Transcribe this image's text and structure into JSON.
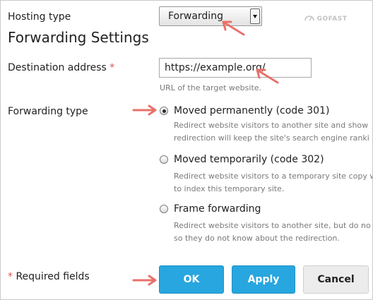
{
  "hosting": {
    "label": "Hosting type",
    "selected": "Forwarding"
  },
  "section_title": "Forwarding Settings",
  "destination": {
    "label": "Destination address",
    "required_mark": "*",
    "value": "https://example.org/",
    "hint": "URL of the target website."
  },
  "forwarding": {
    "label": "Forwarding type",
    "options": [
      {
        "label": "Moved permanently (code 301)",
        "checked": true,
        "desc1": "Redirect website visitors to another site and show",
        "desc2": "redirection will keep the site's search engine ranki"
      },
      {
        "label": "Moved temporarily (code 302)",
        "checked": false,
        "desc1": "Redirect website visitors to a temporary site copy w",
        "desc2": "to index this temporary site."
      },
      {
        "label": "Frame forwarding",
        "checked": false,
        "desc1": "Redirect website visitors to another site, but do no",
        "desc2": "so they do not know about the redirection."
      }
    ]
  },
  "footer": {
    "required_mark": "*",
    "required_text": "Required fields",
    "ok": "OK",
    "apply": "Apply",
    "cancel": "Cancel"
  },
  "watermark": "GOFAST",
  "annotation_color": "#e8716a"
}
